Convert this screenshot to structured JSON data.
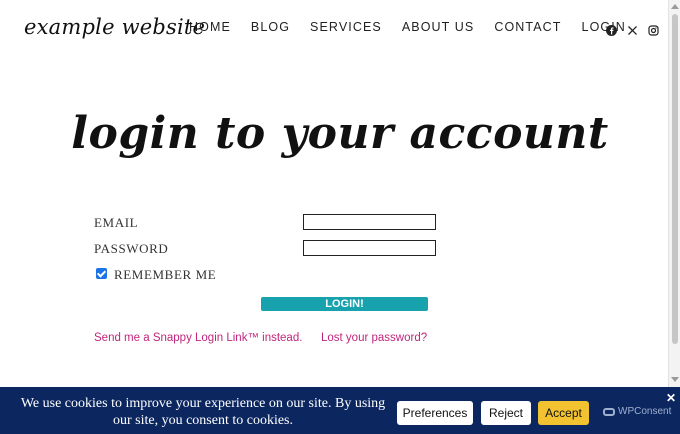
{
  "header": {
    "logo": "example website",
    "nav": [
      "HOME",
      "BLOG",
      "SERVICES",
      "ABOUT US",
      "CONTACT",
      "LOGIN"
    ],
    "social_icons": [
      "facebook-icon",
      "x-icon",
      "instagram-icon"
    ]
  },
  "main": {
    "title": "login to your account",
    "email_label": "EMAIL",
    "password_label": "PASSWORD",
    "remember_label": "REMEMBER ME",
    "remember_checked": true,
    "login_button": "LOGIN!",
    "link_magic": "Send me a Snappy Login Link™ instead.",
    "link_lost": "Lost your password?"
  },
  "cookie": {
    "text": "We use cookies to improve your experience on our site. By using our site, you consent to cookies.",
    "preferences": "Preferences",
    "reject": "Reject",
    "accept": "Accept",
    "brand": "WPConsent",
    "close": "✕"
  },
  "colors": {
    "button_teal": "#18a2ae",
    "link_pink": "#c0267d",
    "banner_navy": "#0c2760",
    "accept_yellow": "#f2c230"
  }
}
